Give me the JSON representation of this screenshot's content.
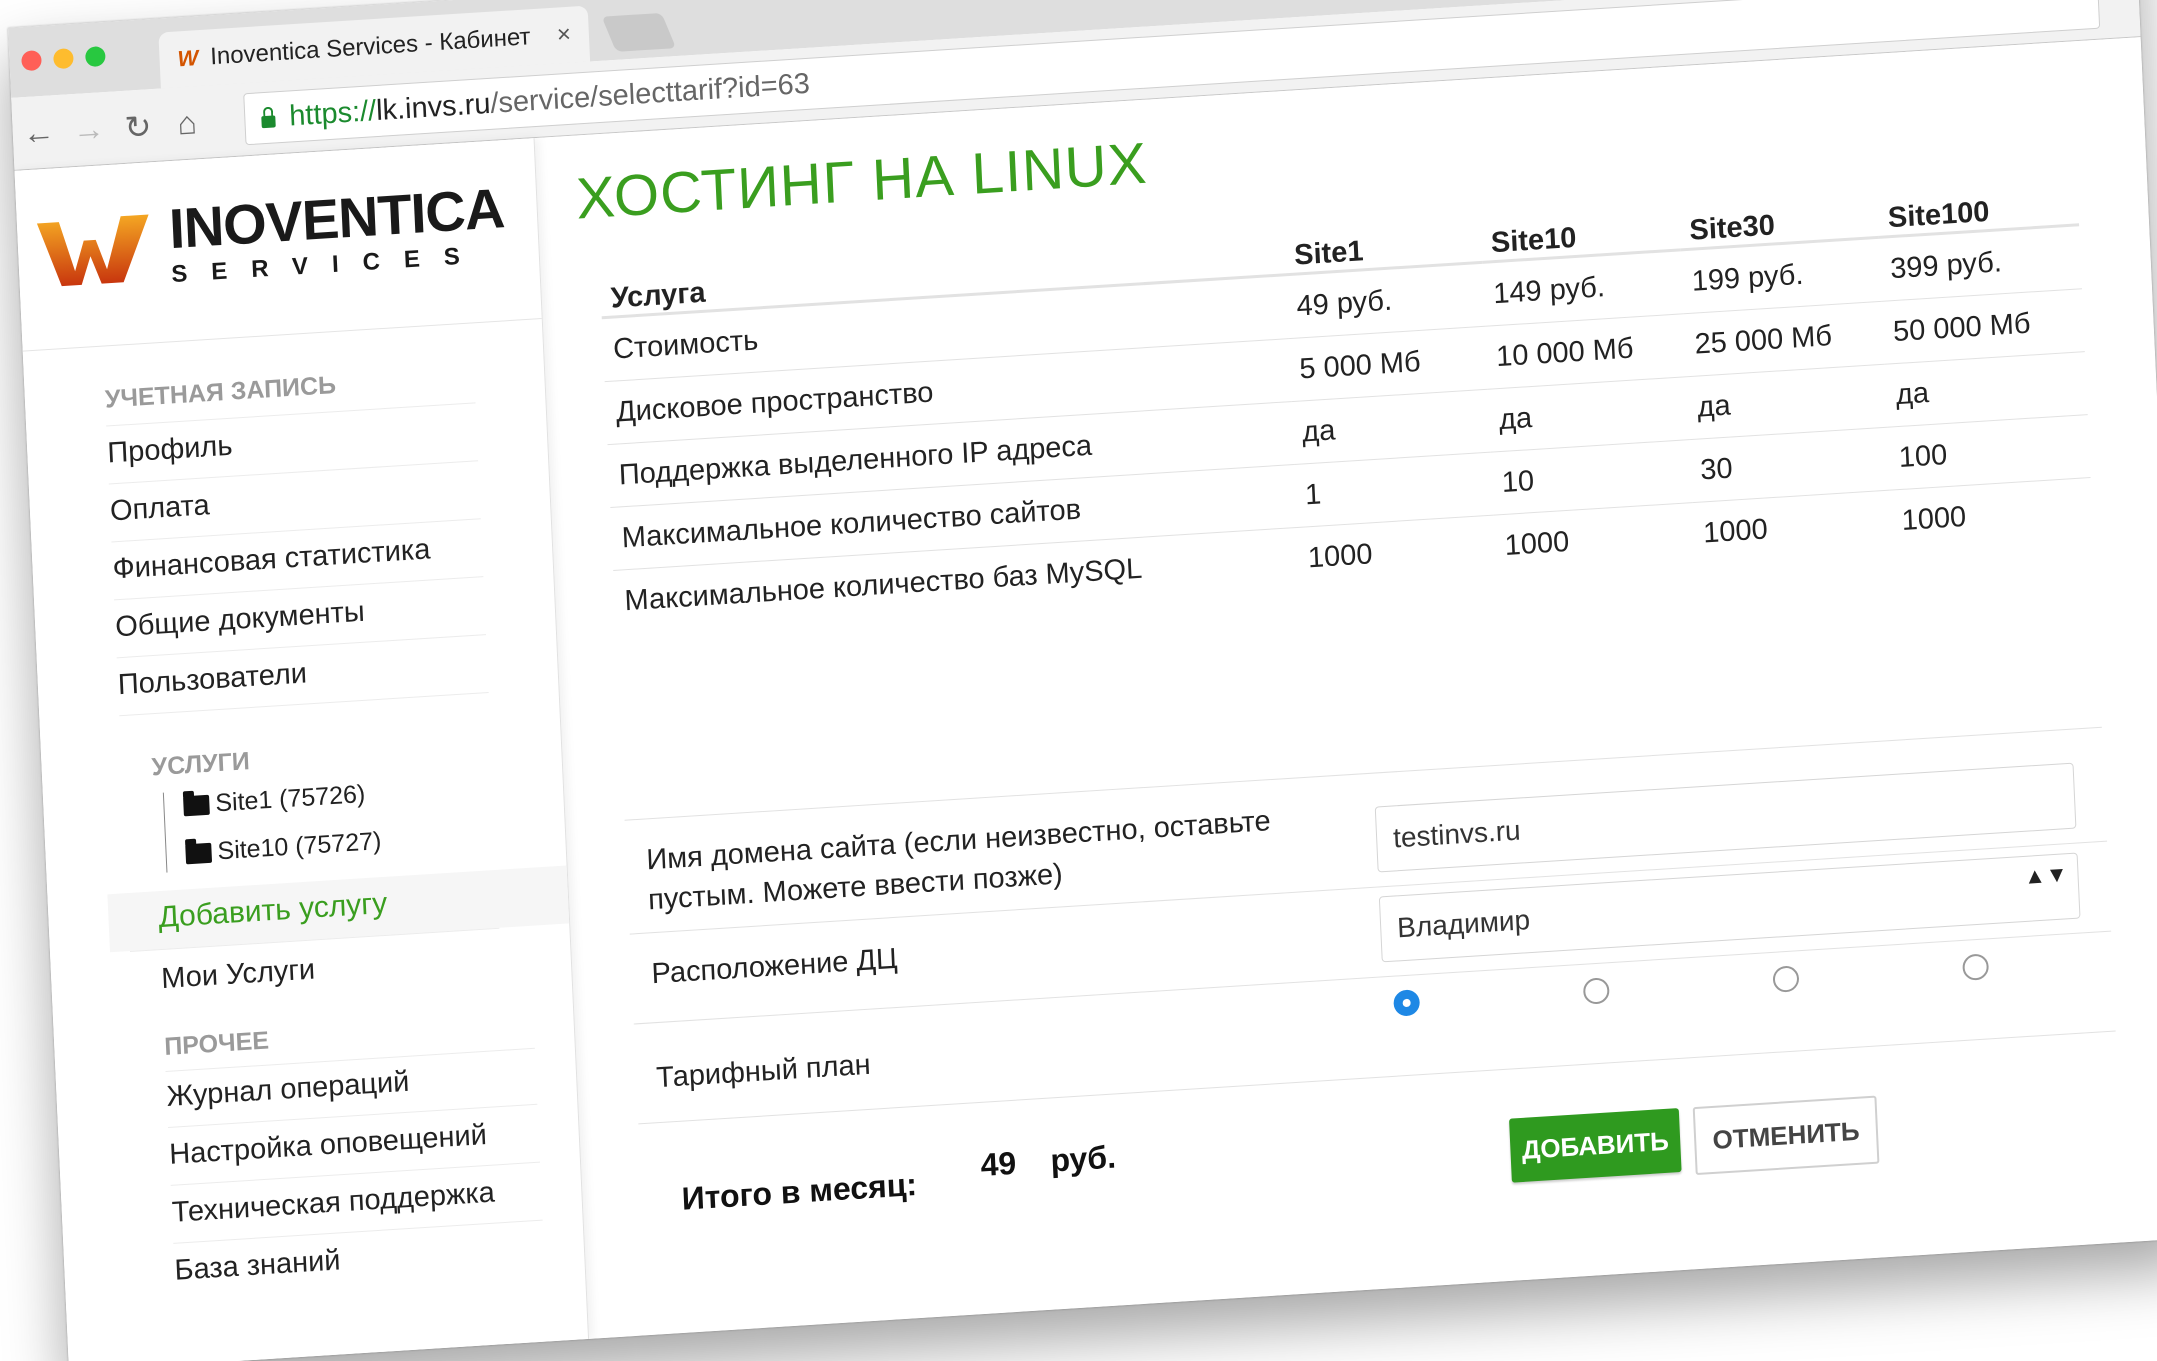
{
  "browser": {
    "tab_title": "Inoventica Services - Кабинет",
    "tab_favicon": "W",
    "tab_close": "×",
    "url_scheme": "https://",
    "url_host": "lk.invs.ru",
    "url_path": "/service/selecttarif?id=63",
    "back_icon": "←",
    "forward_icon": "→",
    "reload_icon": "↻",
    "home_icon": "⌂",
    "star_icon": "☆",
    "traffic_lights": [
      "#ff5f57",
      "#febc2e",
      "#28c840"
    ]
  },
  "logo": {
    "name": "INOVENTICA",
    "sub": "SERVICES"
  },
  "sidebar": {
    "account_header": "УЧЕТНАЯ ЗАПИСЬ",
    "account_items": [
      "Профиль",
      "Оплата",
      "Финансовая статистика",
      "Общие документы",
      "Пользователи"
    ],
    "services_header": "УСЛУГИ",
    "services_tree": [
      "Site1 (75726)",
      "Site10 (75727)"
    ],
    "add_service": "Добавить услугу",
    "my_services": "Мои Услуги",
    "other_header": "ПРОЧЕЕ",
    "other_items": [
      "Журнал операций",
      "Настройка оповещений",
      "Техническая поддержка",
      "База знаний"
    ]
  },
  "main": {
    "title": "ХОСТИНГ НА LINUX",
    "table": {
      "service_header": "Услуга",
      "plans": [
        "Site1",
        "Site10",
        "Site30",
        "Site100"
      ],
      "rows": [
        {
          "label": "Стоимость",
          "values": [
            "49 руб.",
            "149 руб.",
            "199 руб.",
            "399 руб."
          ]
        },
        {
          "label": "Дисковое пространство",
          "values": [
            "5 000 Мб",
            "10 000 Мб",
            "25 000 Мб",
            "50 000 Мб"
          ]
        },
        {
          "label": "Поддержка выделенного IP адреса",
          "values": [
            "да",
            "да",
            "да",
            "да"
          ]
        },
        {
          "label": "Максимальное количество сайтов",
          "values": [
            "1",
            "10",
            "30",
            "100"
          ]
        },
        {
          "label": "Максимальное количество баз MySQL",
          "values": [
            "1000",
            "1000",
            "1000",
            "1000"
          ]
        }
      ]
    },
    "domain_label_line1": "Имя домена сайта (если неизвестно, оставьте",
    "domain_label_line2": "пустым. Можете ввести позже)",
    "domain_value": "testinvs.ru",
    "dc_label": "Расположение ДЦ",
    "dc_value": "Владимир",
    "dc_arrows": "▲▼",
    "plan_label": "Тарифный план",
    "selected_plan_index": 0,
    "total_label": "Итого в месяц:",
    "total_value": "49",
    "total_currency": "руб.",
    "add_button": "ДОБАВИТЬ",
    "cancel_button": "ОТМЕНИТЬ",
    "accent_color": "#3a9e1f",
    "radio_color": "#1e88e5"
  }
}
